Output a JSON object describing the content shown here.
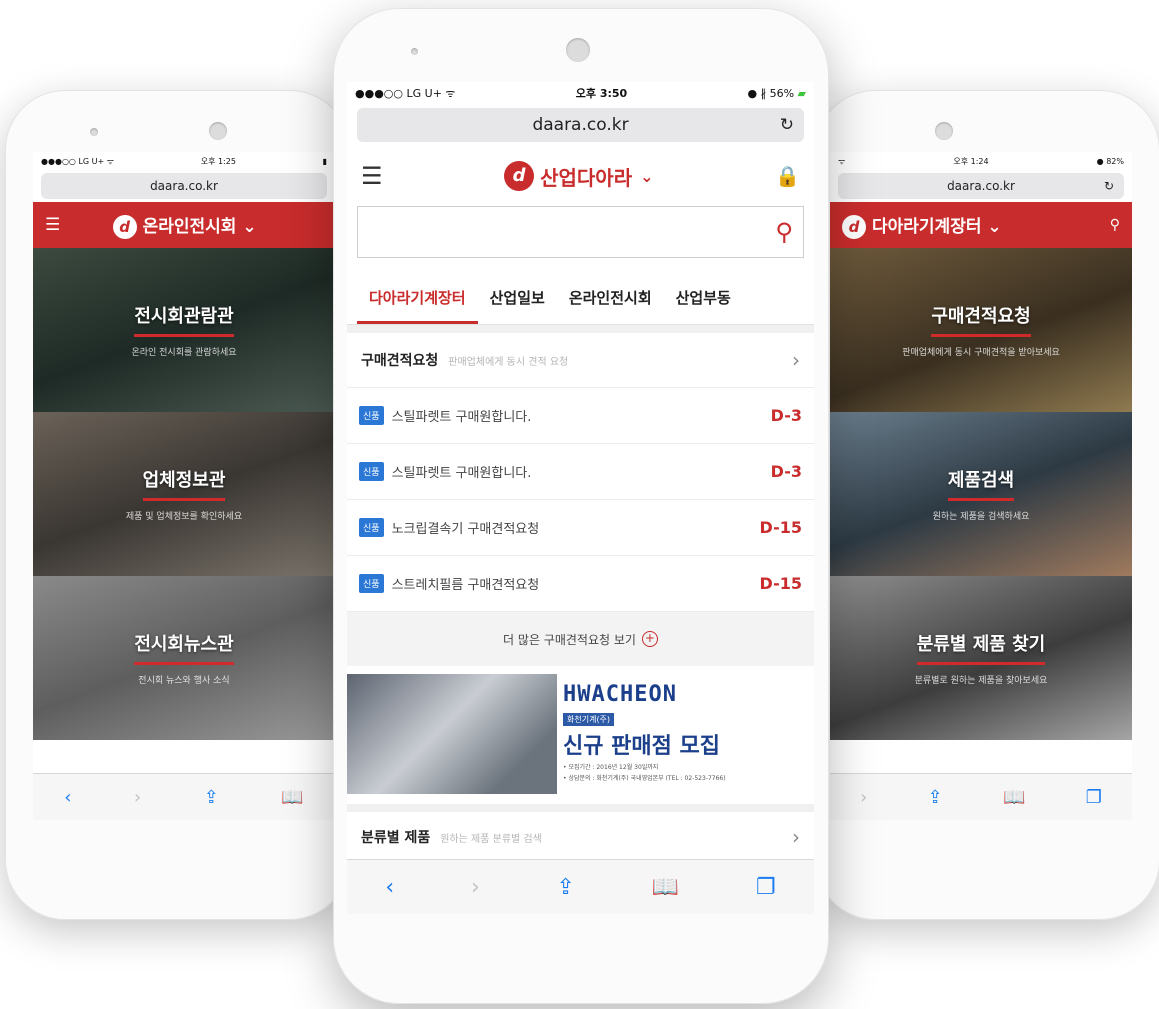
{
  "left_phone": {
    "status": {
      "carrier": "●●●○○ LG U+ ᯤ",
      "time": "오후 1:25"
    },
    "url": "daara.co.kr",
    "header_title": "온라인전시회",
    "tiles": [
      {
        "title": "전시회관람관",
        "subtitle": "온라인 전시회를 관람하세요"
      },
      {
        "title": "업체정보관",
        "subtitle": "제품 및 업체정보를 확인하세요"
      },
      {
        "title": "전시회뉴스관",
        "subtitle": "전시회 뉴스와 행사 소식"
      }
    ]
  },
  "right_phone": {
    "status": {
      "time": "오후 1:24",
      "battery": "● 82%"
    },
    "url": "daara.co.kr",
    "header_title": "다아라기계장터",
    "tiles": [
      {
        "title": "구매견적요청",
        "subtitle": "판매업체에게 동시 구매견적을 받아보세요"
      },
      {
        "title": "제품검색",
        "subtitle": "원하는 제품을 검색하세요"
      },
      {
        "title": "분류별 제품 찾기",
        "subtitle": "분류별로 원하는 제품을 찾아보세요"
      }
    ]
  },
  "center_phone": {
    "status": {
      "carrier": "●●●○○ LG U+ ᯤ",
      "time": "오후 3:50",
      "battery": "● ∦ 56%"
    },
    "url": "daara.co.kr",
    "brand": "산업다아라",
    "tabs": [
      "다아라기계장터",
      "산업일보",
      "온라인전시회",
      "산업부동"
    ],
    "section": {
      "title": "구매견적요청",
      "subtitle": "판매업체에게 동시 견적 요청"
    },
    "requests": [
      {
        "badge": "신품",
        "text": "스틸파렛트 구매원합니다.",
        "deadline": "D-3"
      },
      {
        "badge": "신품",
        "text": "스틸파렛트 구매원합니다.",
        "deadline": "D-3"
      },
      {
        "badge": "신품",
        "text": "노크립결속기 구매견적요청",
        "deadline": "D-15"
      },
      {
        "badge": "신품",
        "text": "스트레치필름 구매견적요청",
        "deadline": "D-15"
      }
    ],
    "more_label": "더 많은 구매견적요청 보기",
    "banner": {
      "brand": "HWACHEON",
      "company": "화천기계(주)",
      "headline": "신규 판매점 모집",
      "line1": "• 모집기간 : 2016년 12월 30일까지",
      "line2": "• 상담문의 : 화천기계(주) 국내영업본부 (TEL : 02-523-7766)"
    },
    "section2": {
      "title": "분류별 제품",
      "subtitle": "원하는 제품 분류별 검색"
    }
  },
  "colors": {
    "brand_red": "#c92c2c",
    "ios_blue": "#1a7cf0",
    "badge_blue": "#2a77d6"
  }
}
